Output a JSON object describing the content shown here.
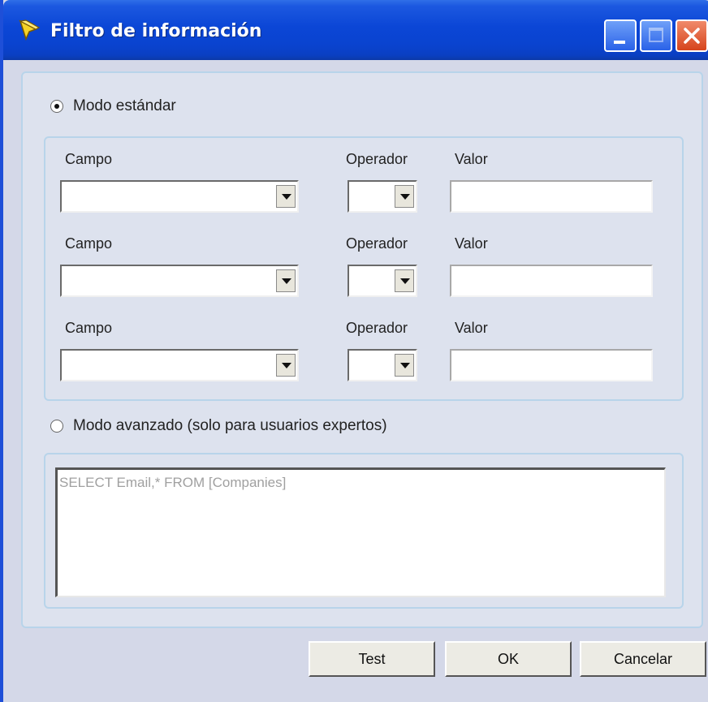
{
  "window": {
    "title": "Filtro de información"
  },
  "standard_mode": {
    "label": "Modo estándar",
    "selected": true,
    "rows": [
      {
        "field_label": "Campo",
        "operator_label": "Operador",
        "value_label": "Valor",
        "field_value": "",
        "operator_value": "",
        "value": ""
      },
      {
        "field_label": "Campo",
        "operator_label": "Operador",
        "value_label": "Valor",
        "field_value": "",
        "operator_value": "",
        "value": ""
      },
      {
        "field_label": "Campo",
        "operator_label": "Operador",
        "value_label": "Valor",
        "field_value": "",
        "operator_value": "",
        "value": ""
      }
    ]
  },
  "advanced_mode": {
    "label": "Modo avanzado (solo para usuarios expertos)",
    "selected": false,
    "query": "SELECT Email,* FROM [Companies]"
  },
  "buttons": {
    "test": "Test",
    "ok": "OK",
    "cancel": "Cancelar"
  },
  "colors": {
    "titlebar": "#0a43cf",
    "window_bg": "#d4d8e8",
    "group_border": "#b8d4ea",
    "close_button": "#d6441c"
  }
}
